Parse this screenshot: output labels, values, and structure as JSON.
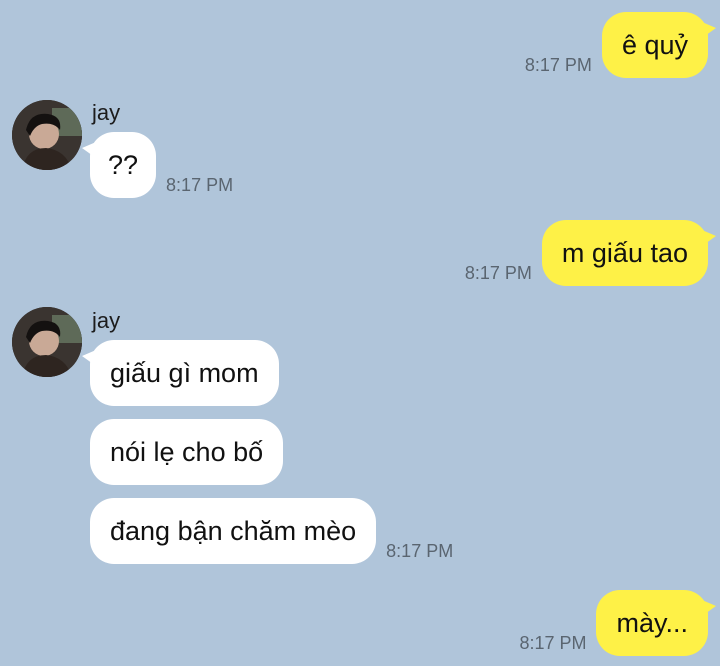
{
  "messages": [
    {
      "side": "out",
      "text": "ê quỷ",
      "time": "8:17 PM"
    },
    {
      "side": "in",
      "sender": "jay",
      "text": "??",
      "time": "8:17 PM"
    },
    {
      "side": "out",
      "text": "m giấu tao",
      "time": "8:17 PM"
    },
    {
      "side": "in",
      "sender": "jay",
      "texts": [
        "giấu gì mom",
        "nói lẹ cho bố",
        "đang bận chăm mèo"
      ],
      "time": "8:17 PM"
    },
    {
      "side": "out",
      "text": "mày...",
      "time": "8:17 PM"
    }
  ],
  "colors": {
    "background": "#b0c5da",
    "outgoing_bubble": "#fef147",
    "incoming_bubble": "#ffffff"
  },
  "icons": {
    "avatar": "profile-photo"
  }
}
